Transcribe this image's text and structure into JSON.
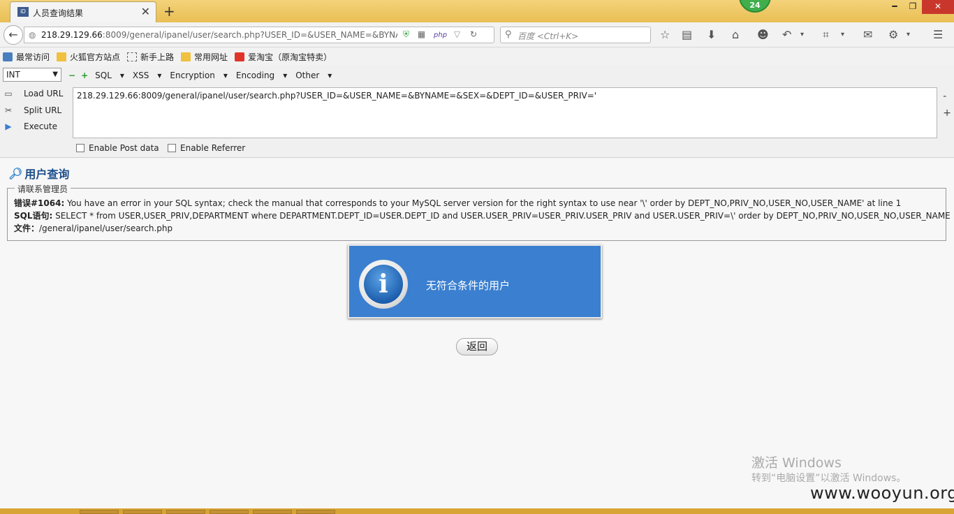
{
  "browser": {
    "tab_title": "人员查询结果",
    "tab_favicon_text": "iD",
    "new_tab_label": "+",
    "badge_count": "24",
    "address_url_host": "218.29.129.66",
    "address_url_rest": ":8009/general/ipanel/user/search.php?USER_ID=&USER_NAME=&BYNAME",
    "search_placeholder": "百度 <Ctrl+K>",
    "php_label": "php"
  },
  "bookmarks": [
    {
      "label": "最常访问",
      "icon": "gear-icon"
    },
    {
      "label": "火狐官方站点",
      "icon": "folder-icon"
    },
    {
      "label": "新手上路",
      "icon": "page-icon"
    },
    {
      "label": "常用网址",
      "icon": "folder-icon"
    },
    {
      "label": "爱淘宝（原淘宝特卖）",
      "icon": "taobao-icon"
    }
  ],
  "hackbar": {
    "type_select": "INT",
    "menu": [
      "SQL",
      "XSS",
      "Encryption",
      "Encoding",
      "Other"
    ],
    "load_url": "Load URL",
    "split_url": "Split URL",
    "execute": "Execute",
    "url_value": "218.29.129.66:8009/general/ipanel/user/search.php?USER_ID=&USER_NAME=&BYNAME=&SEX=&DEPT_ID=&USER_PRIV='",
    "enable_post": "Enable Post data",
    "enable_referrer": "Enable Referrer"
  },
  "page": {
    "heading": "用户查询",
    "error_legend": "请联系管理员",
    "error_label": "错误#1064:",
    "error_text": " You have an error in your SQL syntax; check the manual that corresponds to your MySQL server version for the right syntax to use near '\\' order by DEPT_NO,PRIV_NO,USER_NO,USER_NAME' at line 1",
    "sql_label": "SQL语句:",
    "sql_text": " SELECT * from USER,USER_PRIV,DEPARTMENT where DEPARTMENT.DEPT_ID=USER.DEPT_ID and USER.USER_PRIV=USER_PRIV.USER_PRIV and USER.USER_PRIV=\\' order by DEPT_NO,PRIV_NO,USER_NO,USER_NAME",
    "file_label": "文件：",
    "file_text": "/general/ipanel/user/search.php",
    "message": "无符合条件的用户",
    "info_glyph": "i",
    "back_button": "返回"
  },
  "watermark": {
    "line1": "激活 Windows",
    "line2": "转到“电脑设置”以激活 Windows。",
    "site": "www.wooyun.org"
  }
}
